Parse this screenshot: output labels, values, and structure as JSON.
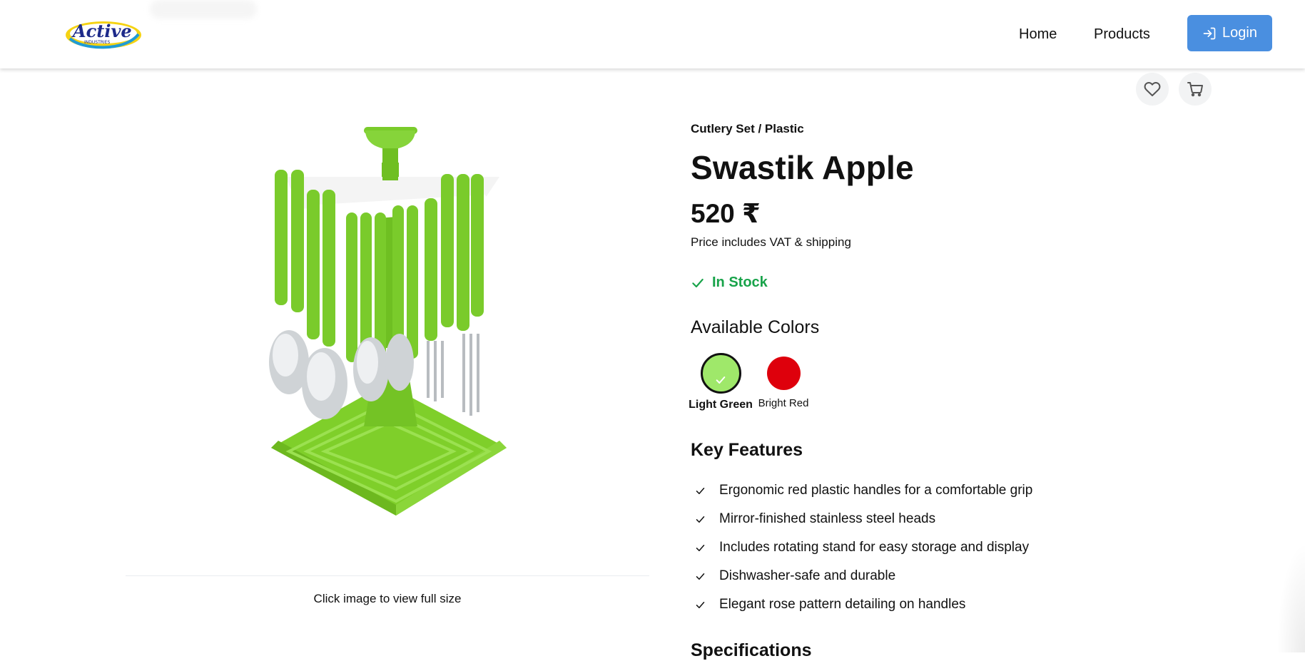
{
  "header": {
    "logo_text": "Active",
    "logo_subtext": "INDUSTRIES",
    "nav": [
      {
        "label": "Home"
      },
      {
        "label": "Products"
      }
    ],
    "login_label": "Login",
    "login_icon": "login-icon"
  },
  "actions": {
    "wishlist_icon": "heart-icon",
    "cart_icon": "cart-icon"
  },
  "gallery": {
    "caption": "Click image to view full size"
  },
  "product": {
    "breadcrumb": "Cutlery Set / Plastic",
    "name": "Swastik Apple",
    "price": "520 ₹",
    "price_note": "Price includes VAT & shipping",
    "stock": "In Stock",
    "stock_color": "#18a34a",
    "colors_heading": "Available Colors",
    "colors": [
      {
        "name": "Light Green",
        "hex": "#9fe86a",
        "selected": true
      },
      {
        "name": "Bright Red",
        "hex": "#de000c",
        "selected": false
      }
    ],
    "features_heading": "Key Features",
    "features": [
      "Ergonomic red plastic handles for a comfortable grip",
      "Mirror-finished stainless steel heads",
      "Includes rotating stand for easy storage and display",
      "Dishwasher-safe and durable",
      "Elegant rose pattern detailing on handles"
    ],
    "specifications_heading": "Specifications"
  },
  "theme": {
    "accent": "#4a8fe0"
  }
}
